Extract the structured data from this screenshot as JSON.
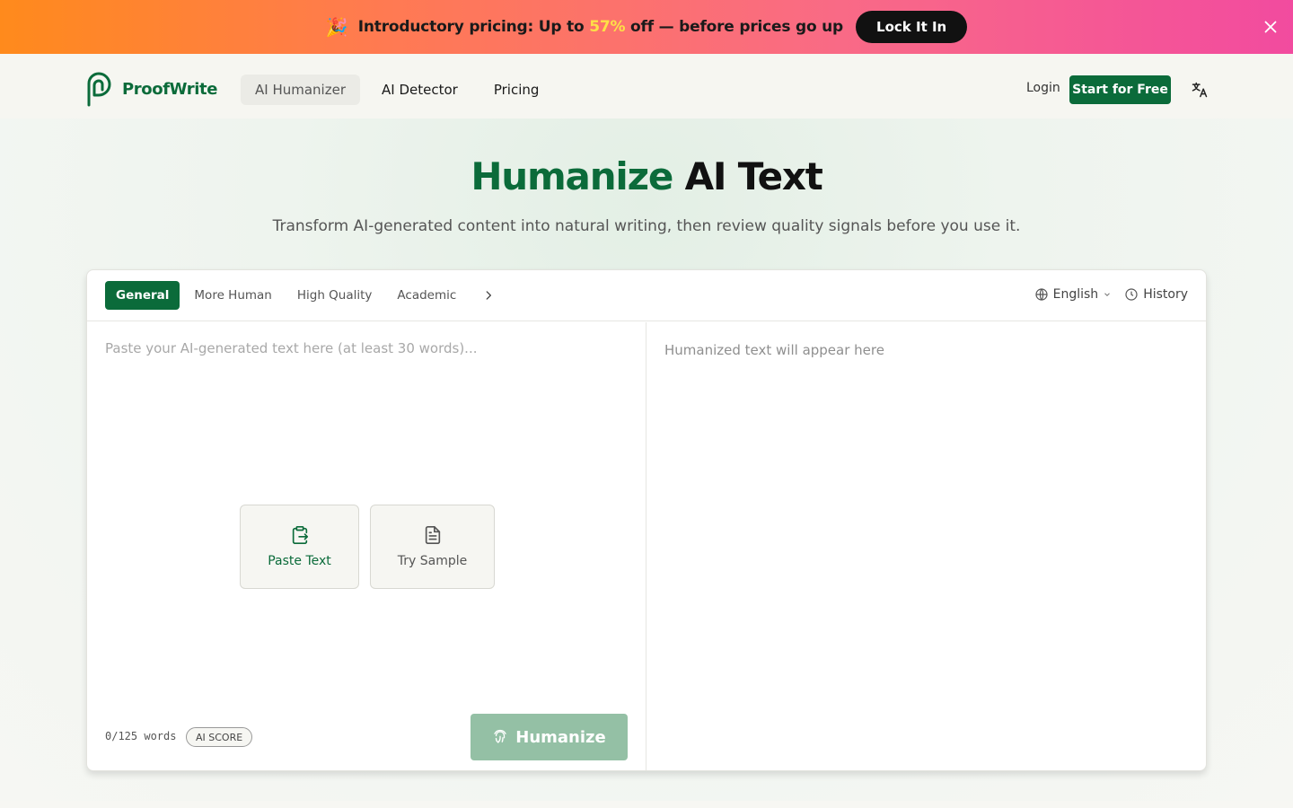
{
  "banner": {
    "icon": "party-popper-icon",
    "text_before": "Introductory pricing: Up to ",
    "highlight": "57%",
    "text_after": " off — before prices go up",
    "cta": "Lock It In",
    "highlight_color": "#fde047"
  },
  "nav": {
    "brand": "ProofWrite",
    "links": [
      "AI Humanizer",
      "AI Detector",
      "Pricing"
    ],
    "active_link": "AI Humanizer",
    "login": "Login",
    "start": "Start for Free",
    "brand_color": "#0b6b3a"
  },
  "hero": {
    "title_green": "Humanize",
    "title_rest": " AI Text",
    "subtitle": "Transform AI-generated content into natural writing, then review quality signals before you use it."
  },
  "tool": {
    "modes": [
      "General",
      "More Human",
      "High Quality",
      "Academic"
    ],
    "active_mode": "General",
    "language": "English",
    "history": "History",
    "input_placeholder": "Paste your AI-generated text here (at least 30 words)...",
    "input_value": "",
    "output_placeholder": "Humanized text will appear here",
    "paste_label": "Paste Text",
    "sample_label": "Try Sample",
    "word_count": "0/125 words",
    "ai_score": "AI SCORE",
    "humanize": "Humanize"
  }
}
